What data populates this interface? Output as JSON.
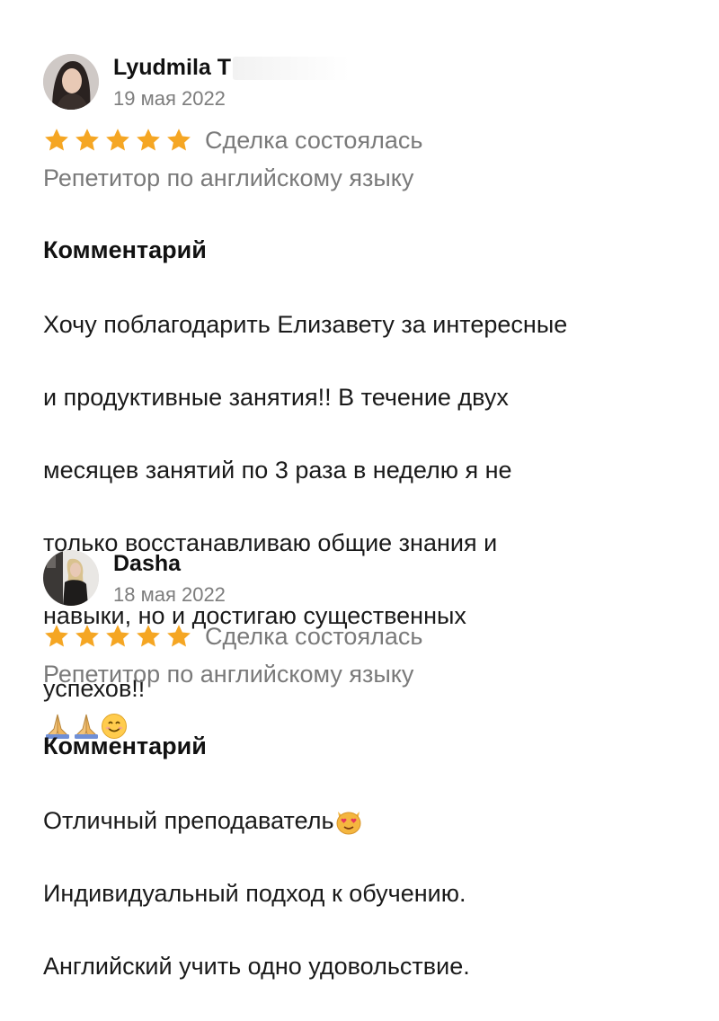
{
  "reviews": [
    {
      "author": "Lyudmila T",
      "date": "19 мая 2022",
      "rating": 5,
      "deal_status": "Сделка состоялась",
      "service": "Репетитор по английскому языку",
      "comment_title": "Комментарий",
      "comment_lines": [
        "Хочу поблагодарить Елизавету за интересные",
        "и продуктивные занятия!! В течение двух",
        "месяцев занятий по 3 раза в неделю я не",
        "только восстанавливаю общие знания и",
        "навыки, но и достигаю существенных",
        "успехов!!"
      ],
      "trailing_emoji": [
        "folded-hands-emoji",
        "folded-hands-emoji",
        "smiling-face-emoji"
      ]
    },
    {
      "author": "Dasha",
      "date": "18 мая 2022",
      "rating": 5,
      "deal_status": "Сделка состоялась",
      "service": "Репетитор по английскому языку",
      "comment_title": "Комментарий",
      "comment_lines": [
        "Отличный преподаватель",
        "Индивидуальный подход к обучению.",
        "Английский учить одно удовольствие."
      ],
      "inline_emoji": "heart-eyes-cat-emoji"
    }
  ],
  "colors": {
    "star": "#f5a623",
    "muted_text": "#7a7a7a",
    "primary_text": "#1a1a1a"
  }
}
